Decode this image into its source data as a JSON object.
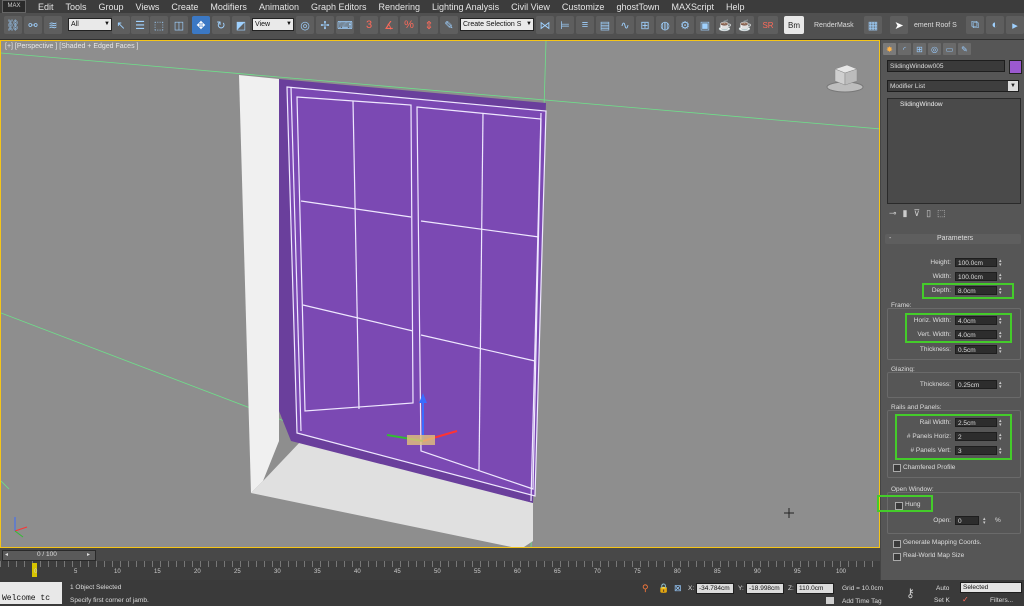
{
  "menu": {
    "logo": "MAX",
    "items": [
      "Edit",
      "Tools",
      "Group",
      "Views",
      "Create",
      "Modifiers",
      "Animation",
      "Graph Editors",
      "Rendering",
      "Lighting Analysis",
      "Civil View",
      "Customize",
      "ghostTown",
      "MAXScript",
      "Help"
    ]
  },
  "toolbar": {
    "selection_filter": "All",
    "ref_coord": "View",
    "selection_set": "Create Selection S",
    "sr_label": "SR",
    "bm_label": "Bm",
    "render_mask": "RenderMask",
    "element_roof": "ement Roof S"
  },
  "viewport": {
    "label": "[+] [Perspective ] [Shaded + Edged Faces ]"
  },
  "panel": {
    "object_name": "SlidingWindow005",
    "object_color": "#9b59d0",
    "modifier_list": "Modifier List",
    "stack_item": "SlidingWindow",
    "rollout_title": "Parameters",
    "rollout_toggle": "-",
    "height_label": "Height:",
    "height_value": "100.0cm",
    "width_label": "Width:",
    "width_value": "100.0cm",
    "depth_label": "Depth:",
    "depth_value": "8.0cm",
    "frame_section": "Frame:",
    "horiz_width_label": "Horiz. Width:",
    "horiz_width_value": "4.0cm",
    "vert_width_label": "Vert. Width:",
    "vert_width_value": "4.0cm",
    "thickness_label": "Thickness:",
    "thickness_value": "0.5cm",
    "glazing_section": "Glazing:",
    "glazing_thickness_label": "Thickness:",
    "glazing_thickness_value": "0.25cm",
    "rails_section": "Rails and Panels:",
    "rail_width_label": "Rail Width:",
    "rail_width_value": "2.5cm",
    "panels_horiz_label": "# Panels Horiz:",
    "panels_horiz_value": "2",
    "panels_vert_label": "# Panels Vert:",
    "panels_vert_value": "3",
    "chamfered_label": "Chamfered Profile",
    "open_window_section": "Open Window:",
    "hung_label": "Hung",
    "open_label": "Open:",
    "open_value": "0",
    "open_unit": "%",
    "gen_mapping_label": "Generate Mapping Coords.",
    "real_world_label": "Real-World Map Size"
  },
  "timeline": {
    "frame_counter": "0 / 100",
    "ticks": [
      "0",
      "5",
      "10",
      "15",
      "20",
      "25",
      "30",
      "35",
      "40",
      "45",
      "50",
      "55",
      "60",
      "65",
      "70",
      "75",
      "80",
      "85",
      "90",
      "95",
      "100"
    ]
  },
  "status": {
    "listener": "Welcome tc",
    "selected_count": "1 Object Selected",
    "prompt": "Specify first corner of jamb.",
    "x_label": "X:",
    "x_value": "-34.784cm",
    "y_label": "Y:",
    "y_value": "-18.998cm",
    "z_label": "Z:",
    "z_value": "110.0cm",
    "grid": "Grid = 10.0cm",
    "add_time_tag": "Add Time Tag",
    "auto_label": "Auto",
    "set_key_label": "Set K",
    "selected_dropdown": "Selected",
    "filters_label": "Filters..."
  }
}
